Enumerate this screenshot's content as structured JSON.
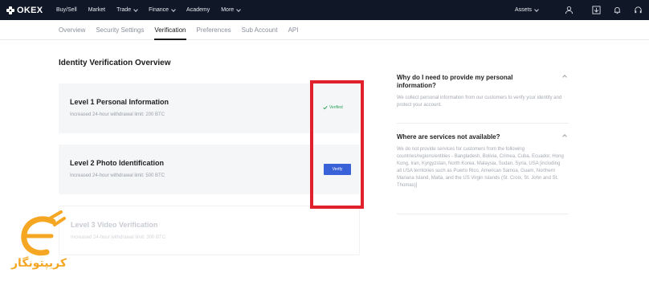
{
  "brand": {
    "name": "OKEX"
  },
  "nav": {
    "items": [
      {
        "label": "Buy/Sell",
        "dropdown": false
      },
      {
        "label": "Market",
        "dropdown": false
      },
      {
        "label": "Trade",
        "dropdown": true
      },
      {
        "label": "Finance",
        "dropdown": true
      },
      {
        "label": "Academy",
        "dropdown": false
      },
      {
        "label": "More",
        "dropdown": true
      }
    ],
    "assets_label": "Assets",
    "right_icons": [
      "user-icon",
      "download-icon",
      "bell-icon",
      "headset-icon"
    ]
  },
  "subnav": {
    "tabs": [
      "Overview",
      "Security Settings",
      "Verification",
      "Preferences",
      "Sub Account",
      "API"
    ],
    "active": "Verification"
  },
  "main": {
    "title": "Identity Verification Overview",
    "levels": [
      {
        "title": "Level 1 Personal Information",
        "subtitle": "Increased 24-hour withdrawal limit: 200 BTC",
        "status": "Verified"
      },
      {
        "title": "Level 2 Photo Identification",
        "subtitle": "Increased 24-hour withdrawal limit: 500 BTC",
        "action": "Verify"
      },
      {
        "title": "Level 3 Video Verification",
        "subtitle": "Increased 24-hour withdrawal limit: 300 BTC"
      }
    ]
  },
  "faq": [
    {
      "question": "Why do I need to provide my personal information?",
      "answer": "We collect personal information from our customers to verify your identity and protect your account."
    },
    {
      "question": "Where are services not available?",
      "answer": "We do not provide services for customers from the following countries/regions/entities - Bangladesh, Bolivia, Crimea, Cuba, Ecuador, Hong Kong, Iran, Kyrgyzstan, North Korea, Malaysia, Sudan, Syria, USA [including all USA territories such as Puerto Rico, American Samoa, Guam, Northern Mariana Island, Malta, and the US Virgin Islands (St. Croix, St. John and St. Thomas)]"
    }
  ],
  "watermark": {
    "text": "کریپتونگار"
  },
  "colors": {
    "topbar": "#101828",
    "accent": "#3a62d8",
    "verified": "#27a25a",
    "highlight": "#e0202a",
    "watermark": "#f5a623"
  }
}
